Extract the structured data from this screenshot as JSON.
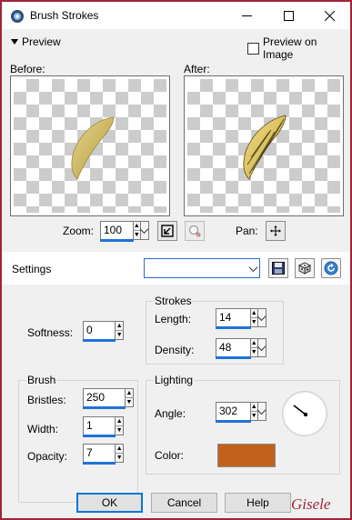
{
  "window": {
    "title": "Brush Strokes"
  },
  "preview": {
    "toggle_label": "Preview",
    "preview_on_image_label": "Preview on Image",
    "preview_on_image_checked": false,
    "before_label": "Before:",
    "after_label": "After:"
  },
  "zoom": {
    "label": "Zoom:",
    "value": "100",
    "pan_label": "Pan:"
  },
  "settings": {
    "label": "Settings",
    "value": ""
  },
  "softness": {
    "label": "Softness:",
    "value": "0"
  },
  "strokes": {
    "title": "Strokes",
    "length_label": "Length:",
    "length_value": "14",
    "density_label": "Density:",
    "density_value": "48"
  },
  "brush": {
    "title": "Brush",
    "bristles_label": "Bristles:",
    "bristles_value": "250",
    "width_label": "Width:",
    "width_value": "1",
    "opacity_label": "Opacity:",
    "opacity_value": "7"
  },
  "lighting": {
    "title": "Lighting",
    "angle_label": "Angle:",
    "angle_value": "302",
    "color_label": "Color:",
    "color_hex": "#c2611c"
  },
  "buttons": {
    "ok": "OK",
    "cancel": "Cancel",
    "help": "Help"
  },
  "signature": "Gisele",
  "colors": {
    "accent": "#1e73d8",
    "frame": "#a0243a",
    "swatch": "#c2611c"
  }
}
